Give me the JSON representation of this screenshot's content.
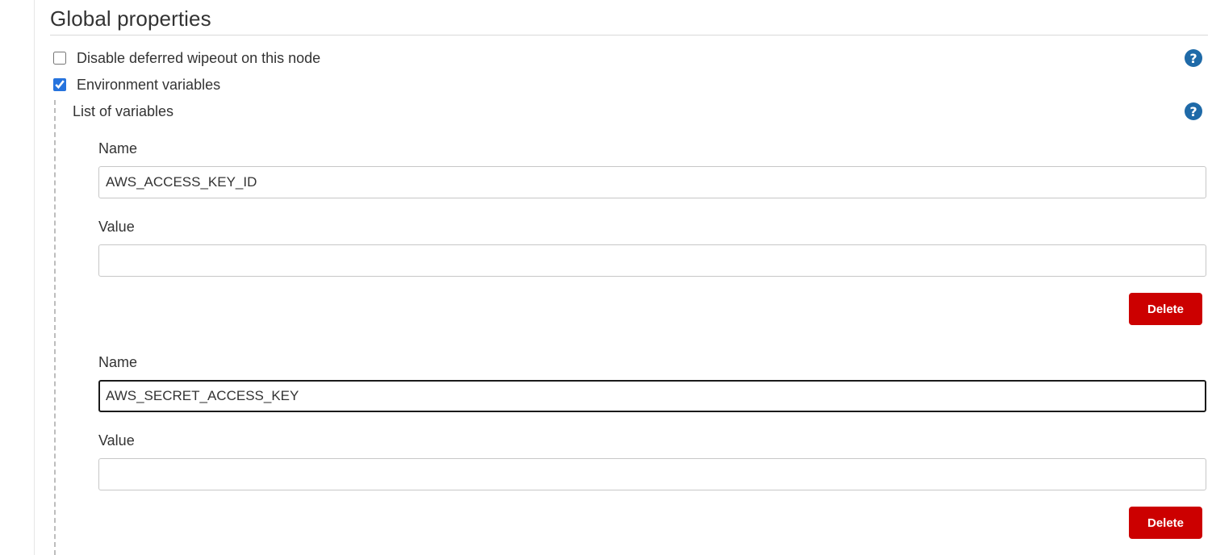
{
  "section": {
    "title": "Global properties"
  },
  "options": [
    {
      "label": "Disable deferred wipeout on this node",
      "checked": false,
      "help_icon": "question-circle-icon"
    },
    {
      "label": "Environment variables",
      "checked": true
    }
  ],
  "env": {
    "list_label": "List of variables",
    "help_icon": "question-circle-icon",
    "help_glyph": "?",
    "variables": [
      {
        "name_label": "Name",
        "name_value": "AWS_ACCESS_KEY_ID",
        "value_label": "Value",
        "value_value": "",
        "delete_label": "Delete"
      },
      {
        "name_label": "Name",
        "name_value": "AWS_SECRET_ACCESS_KEY",
        "value_label": "Value",
        "value_value": "",
        "delete_label": "Delete"
      }
    ]
  },
  "colors": {
    "delete": "#cc0000",
    "help": "#1f6aa8",
    "checkbox": "#2673dd"
  }
}
